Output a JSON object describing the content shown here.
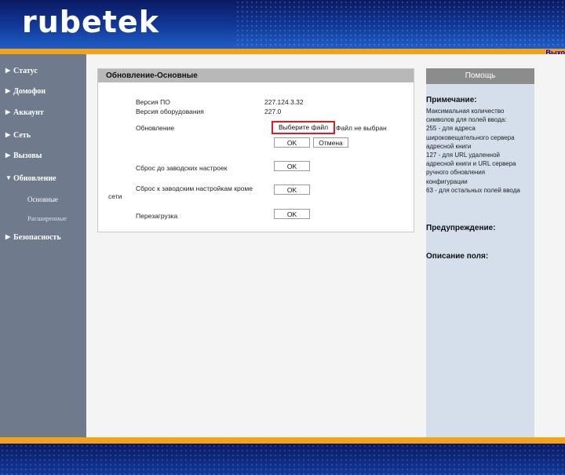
{
  "header": {
    "logo": "rubetek",
    "logout": "Выхо"
  },
  "sidebar": {
    "items": [
      {
        "label": "Статус",
        "arrow": "▶"
      },
      {
        "label": "Домофон",
        "arrow": "▶"
      },
      {
        "label": "Аккаунт",
        "arrow": "▶"
      },
      {
        "label": "Сеть",
        "arrow": "▶"
      },
      {
        "label": "Вызовы",
        "arrow": "▶"
      },
      {
        "label": "Обновление",
        "arrow": "▼"
      },
      {
        "label": "Безопасность",
        "arrow": "▶"
      }
    ],
    "subitems": [
      {
        "label": "Основные"
      },
      {
        "label": "Расширенные"
      }
    ]
  },
  "panel": {
    "title": "Обновление-Основные",
    "firmware_label": "Версия ПО",
    "firmware_value": "227.124.3.32",
    "hardware_label": "Версия оборудования",
    "hardware_value": "227.0",
    "update_label": "Обновление",
    "choose_file": "Выберите файл",
    "no_file": "Файл не выбран",
    "ok": "OK",
    "cancel": "Отмена",
    "reset_label": "Сброс до заводских настроек",
    "reset_except_label": "Сброс к заводским настройкам кроме",
    "reset_except_label2": "сети",
    "reboot_label": "Перезагрузка"
  },
  "help": {
    "title": "Помощь",
    "note_heading": "Примечание:",
    "note_text": "Максимальная количество\nсимволов для полей ввода:\n255 - для адреса\nшироковещательного сервера\nадресной книги\n127 - для URL удаленной\nадресной книги и URL сервера\nручного обновления\nконфигурации\n63 - для остальных полей ввода",
    "warning_heading": "Предупреждение:",
    "field_heading": "Описание поля:"
  }
}
